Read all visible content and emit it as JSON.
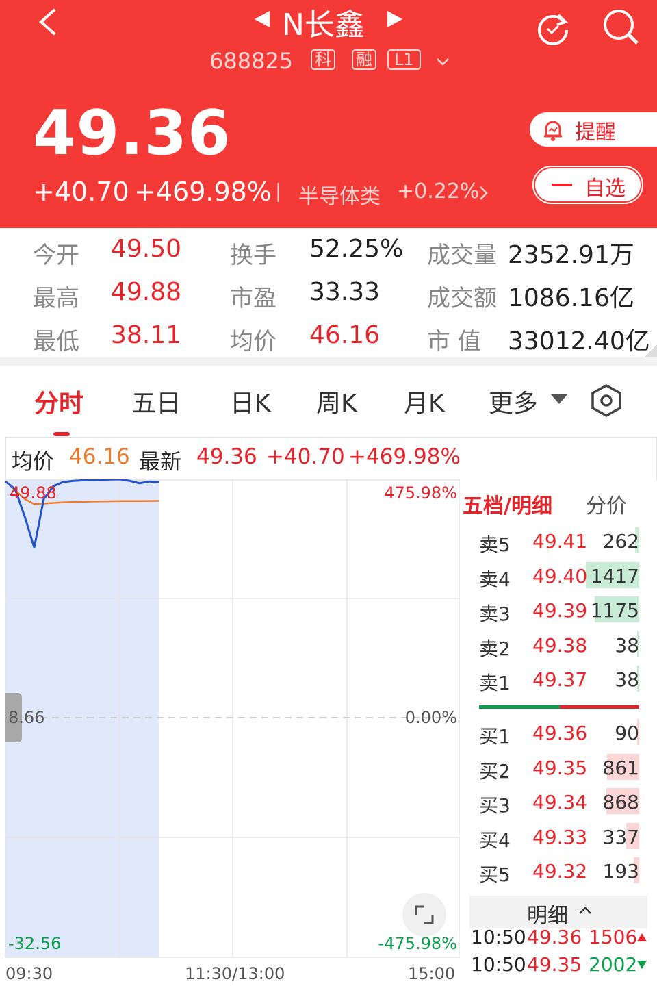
{
  "header": {
    "back_icon": "chevron-left-icon",
    "prev_icon": "triangle-left-icon",
    "next_icon": "triangle-right-icon",
    "title": "N长鑫",
    "code": "688825",
    "badges": [
      "科",
      "融",
      "L1"
    ],
    "dropdown_icon": "chevron-down-icon",
    "refresh_icon": "refresh-icon",
    "search_icon": "search-icon"
  },
  "quote": {
    "price": "49.36",
    "change": "+40.70",
    "change_pct": "+469.98%",
    "divider": "|",
    "sector_name": "半导体类",
    "sector_pct": "+0.22%",
    "alert_label": "提醒",
    "watchlist_label": "自选"
  },
  "stats": {
    "row1": [
      {
        "label": "今开",
        "value": "49.50"
      },
      {
        "label": "换手",
        "value": "52.25%"
      },
      {
        "label": "成交量",
        "value": "2352.91万"
      }
    ],
    "row2": [
      {
        "label": "最高",
        "value": "49.88"
      },
      {
        "label": "市盈",
        "value": "33.33"
      },
      {
        "label": "成交额",
        "value": "1086.16亿"
      }
    ],
    "row3": [
      {
        "label": "最低",
        "value": "38.11"
      },
      {
        "label": "均价",
        "value": "46.16"
      },
      {
        "label": "市 值",
        "value": "33012.40亿"
      }
    ]
  },
  "tabs": [
    "分时",
    "五日",
    "日K",
    "周K",
    "月K",
    "更多"
  ],
  "chart_info": {
    "avg_label": "均价",
    "avg_value": "46.16",
    "latest_label": "最新",
    "latest_value": "49.36",
    "change": "+40.70",
    "change_pct": "+469.98%"
  },
  "chart_axis": {
    "top_left": "49.88",
    "top_right": "475.98%",
    "mid_left": "8.66",
    "mid_right": "0.00%",
    "bottom_left": "-32.56",
    "bottom_right": "-475.98%",
    "time_start": "09:30",
    "time_mid": "11:30/13:00",
    "time_end": "15:00"
  },
  "chart_data": {
    "type": "line",
    "x": [
      "09:30",
      "09:35",
      "09:40",
      "09:45",
      "09:50",
      "09:55",
      "10:00",
      "10:05",
      "10:10",
      "10:15",
      "10:20",
      "10:25",
      "10:30",
      "10:35",
      "10:40",
      "10:45",
      "10:50"
    ],
    "series": [
      {
        "values": [
          49.5,
          48.2,
          43.5,
          38.11,
          46.5,
          48.7,
          49.4,
          49.6,
          49.7,
          49.75,
          49.8,
          49.85,
          49.88,
          49.6,
          49.2,
          49.5,
          49.36
        ]
      },
      {
        "values": [
          49.5,
          48.0,
          46.5,
          45.6,
          45.7,
          45.8,
          45.9,
          45.95,
          46.0,
          46.05,
          46.08,
          46.1,
          46.12,
          46.13,
          46.14,
          46.15,
          46.16
        ]
      }
    ],
    "y_range": [
      -32.56,
      49.88
    ],
    "y_ticks": [
      "49.88",
      "8.66",
      "-32.56"
    ],
    "y2_ticks": [
      "475.98%",
      "0.00%",
      "-475.98%"
    ],
    "x_ticks": [
      "09:30",
      "11:30/13:00",
      "15:00"
    ],
    "colors": {
      "price": "#2255cc",
      "avg": "#ee7a2c"
    },
    "grid": true
  },
  "order_book": {
    "tab_active": "五档/明细",
    "tab_other": "分价",
    "asks": [
      {
        "name": "卖5",
        "price": "49.41",
        "vol": "262",
        "ratio": 0.08
      },
      {
        "name": "卖4",
        "price": "49.40",
        "vol": "1417",
        "ratio": 1.0
      },
      {
        "name": "卖3",
        "price": "49.39",
        "vol": "1175",
        "ratio": 0.83
      },
      {
        "name": "卖2",
        "price": "49.38",
        "vol": "38",
        "ratio": 0.02
      },
      {
        "name": "卖1",
        "price": "49.37",
        "vol": "38",
        "ratio": 0.02
      }
    ],
    "bids": [
      {
        "name": "买1",
        "price": "49.36",
        "vol": "90",
        "ratio": 0.03
      },
      {
        "name": "买2",
        "price": "49.35",
        "vol": "861",
        "ratio": 0.6
      },
      {
        "name": "买3",
        "price": "49.34",
        "vol": "868",
        "ratio": 0.61
      },
      {
        "name": "买4",
        "price": "49.33",
        "vol": "337",
        "ratio": 0.24
      },
      {
        "name": "买5",
        "price": "49.32",
        "vol": "193",
        "ratio": 0.1
      }
    ],
    "detail_label": "明细",
    "ticks": [
      {
        "time": "10:50",
        "price": "49.36",
        "vol": "1506",
        "dir": "up"
      },
      {
        "time": "10:50",
        "price": "49.35",
        "vol": "2002",
        "dir": "down"
      }
    ]
  },
  "colors": {
    "brand_red": "#f43a37",
    "up": "#e8242b",
    "down": "#0b9f4b"
  }
}
